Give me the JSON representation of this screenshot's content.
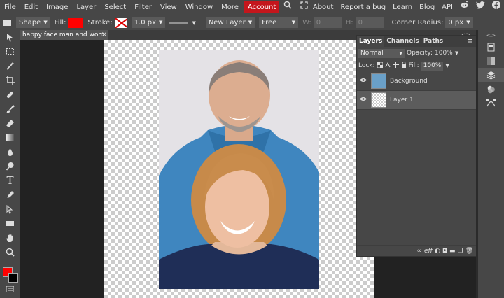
{
  "menu": {
    "items": [
      "File",
      "Edit",
      "Image",
      "Layer",
      "Select",
      "Filter",
      "View",
      "Window",
      "More"
    ],
    "account": "Account",
    "right_items": [
      "About",
      "Report a bug",
      "Learn",
      "Blog",
      "API"
    ]
  },
  "toolbar": {
    "tool_mode": "Shape",
    "fill_label": "Fill:",
    "stroke_label": "Stroke:",
    "stroke_width": "1.0 px",
    "layer_mode": "New Layer",
    "constraint": "Free",
    "w_label": "W:",
    "w_value": "0",
    "h_label": "H:",
    "h_value": "0",
    "corner_radius_label": "Corner Radius:",
    "corner_radius_value": "0 px",
    "colors": {
      "fill": "#ff0000"
    }
  },
  "document": {
    "tab_title": "happy face man and wom",
    "close_symbol": "×"
  },
  "layers_panel": {
    "tabs": [
      "Layers",
      "Channels",
      "Paths"
    ],
    "blend_mode": "Normal",
    "opacity_label": "Opacity:",
    "opacity_value": "100%",
    "lock_label": "Lock:",
    "fill_label": "Fill:",
    "fill_value": "100%",
    "layers": [
      {
        "name": "Background",
        "visible": true,
        "selected": false
      },
      {
        "name": "Layer 1",
        "visible": true,
        "selected": true
      }
    ]
  },
  "colors": {
    "foreground": "#ff0000",
    "background": "#000000"
  }
}
